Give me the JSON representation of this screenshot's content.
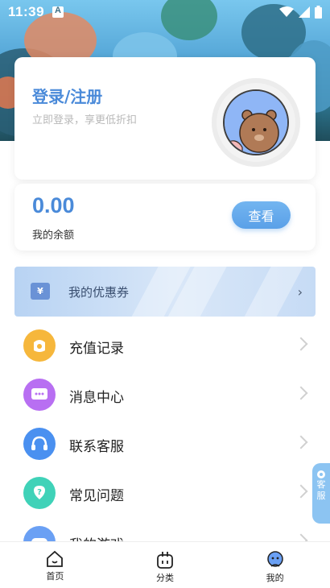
{
  "statusbar": {
    "time": "11:39",
    "notification_glyph": "A"
  },
  "profile": {
    "title": "登录/注册",
    "subtitle": "立即登录，享更低折扣"
  },
  "balance": {
    "value": "0.00",
    "label": "我的余额",
    "view_button": "查看"
  },
  "coupon": {
    "icon_glyph": "¥",
    "label": "我的优惠券"
  },
  "menu": [
    {
      "label": "充值记录",
      "icon": "wallet-icon",
      "color": "#f6b73c"
    },
    {
      "label": "消息中心",
      "icon": "message-icon",
      "color": "#b86ff2"
    },
    {
      "label": "联系客服",
      "icon": "headset-icon",
      "color": "#4a90f0"
    },
    {
      "label": "常见问题",
      "icon": "question-icon",
      "color": "#3fd2b8"
    },
    {
      "label": "我的游戏",
      "icon": "gamepad-icon",
      "color": "#6aa0f4"
    }
  ],
  "float_service": {
    "label_1": "客",
    "label_2": "服"
  },
  "nav": [
    {
      "label": "首页",
      "icon": "home-icon"
    },
    {
      "label": "分类",
      "icon": "category-icon"
    },
    {
      "label": "我的",
      "icon": "profile-icon"
    }
  ],
  "colors": {
    "accent": "#4a8ad9",
    "button": "#5aa0e8"
  }
}
